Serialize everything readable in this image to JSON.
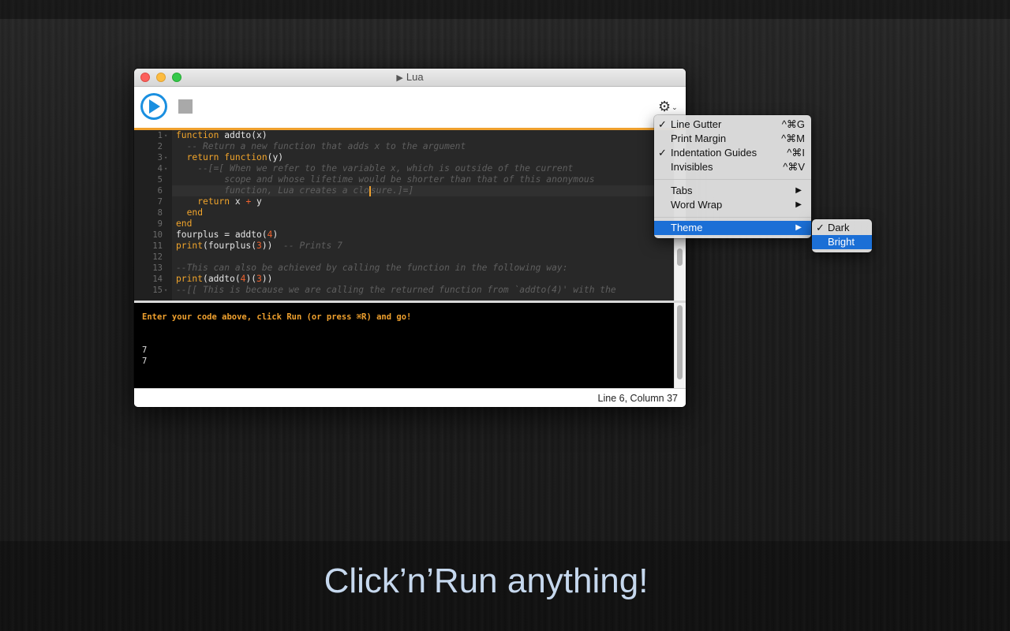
{
  "window": {
    "title": "Lua"
  },
  "editor": {
    "lines": [
      {
        "n": "1",
        "fold": "▾"
      },
      {
        "n": "2"
      },
      {
        "n": "3",
        "fold": "▾"
      },
      {
        "n": "4",
        "fold": "▾"
      },
      {
        "n": "5"
      },
      {
        "n": "6"
      },
      {
        "n": "7"
      },
      {
        "n": "8"
      },
      {
        "n": "9"
      },
      {
        "n": "10"
      },
      {
        "n": "11"
      },
      {
        "n": "12"
      },
      {
        "n": "13"
      },
      {
        "n": "14"
      },
      {
        "n": "15",
        "fold": "▾"
      }
    ],
    "code": {
      "l1_kw": "function",
      "l1_rest": " addto(x)",
      "l2": "  -- Return a new function that adds x to the argument",
      "l3_ws": "  ",
      "l3_kw1": "return",
      "l3_sp": " ",
      "l3_kw2": "function",
      "l3_rest": "(y)",
      "l4": "    --[=[ When we refer to the variable x, which is outside of the current",
      "l5": "         scope and whose lifetime would be shorter than that of this anonymous",
      "l6_a": "         function, Lua creates a clo",
      "l6_b": "sure.]=]",
      "l7_ws": "    ",
      "l7_kw": "return",
      "l7_a": " x ",
      "l7_op": "+",
      "l7_b": " y",
      "l8_ws": "  ",
      "l8_kw": "end",
      "l9_kw": "end",
      "l10_a": "fourplus = addto(",
      "l10_num": "4",
      "l10_b": ")",
      "l11_kw": "print",
      "l11_a": "(fourplus(",
      "l11_num": "3",
      "l11_b": "))",
      "l11_cm": "  -- Prints 7",
      "l13": "--This can also be achieved by calling the function in the following way:",
      "l14_kw": "print",
      "l14_a": "(addto(",
      "l14_num1": "4",
      "l14_b": ")(",
      "l14_num2": "3",
      "l14_c": "))",
      "l15": "--[[ This is because we are calling the returned function from `addto(4)' with the"
    }
  },
  "console": {
    "prompt": "Enter your code above, click Run (or press ⌘R) and go!",
    "output": [
      "7",
      "7"
    ]
  },
  "status": {
    "position": "Line 6, Column 37"
  },
  "settings_menu": {
    "items": [
      {
        "label": "Line Gutter",
        "shortcut": "^⌘G",
        "checked": "✓"
      },
      {
        "label": "Print Margin",
        "shortcut": "^⌘M",
        "checked": ""
      },
      {
        "label": "Indentation Guides",
        "shortcut": "^⌘I",
        "checked": "✓"
      },
      {
        "label": "Invisibles",
        "shortcut": "^⌘V",
        "checked": ""
      },
      {
        "label": "Tabs",
        "arrow": "▶"
      },
      {
        "label": "Word Wrap",
        "arrow": "▶"
      },
      {
        "label": "Theme",
        "arrow": "▶"
      }
    ]
  },
  "theme_menu": {
    "items": [
      {
        "label": "Dark",
        "checked": "✓"
      },
      {
        "label": "Bright",
        "checked": ""
      }
    ]
  },
  "tagline": "Click’n’Run anything!",
  "colors": {
    "accent": "#f0a12e",
    "run_blue": "#1a8fe0",
    "menu_highlight": "#1b6fd6"
  }
}
